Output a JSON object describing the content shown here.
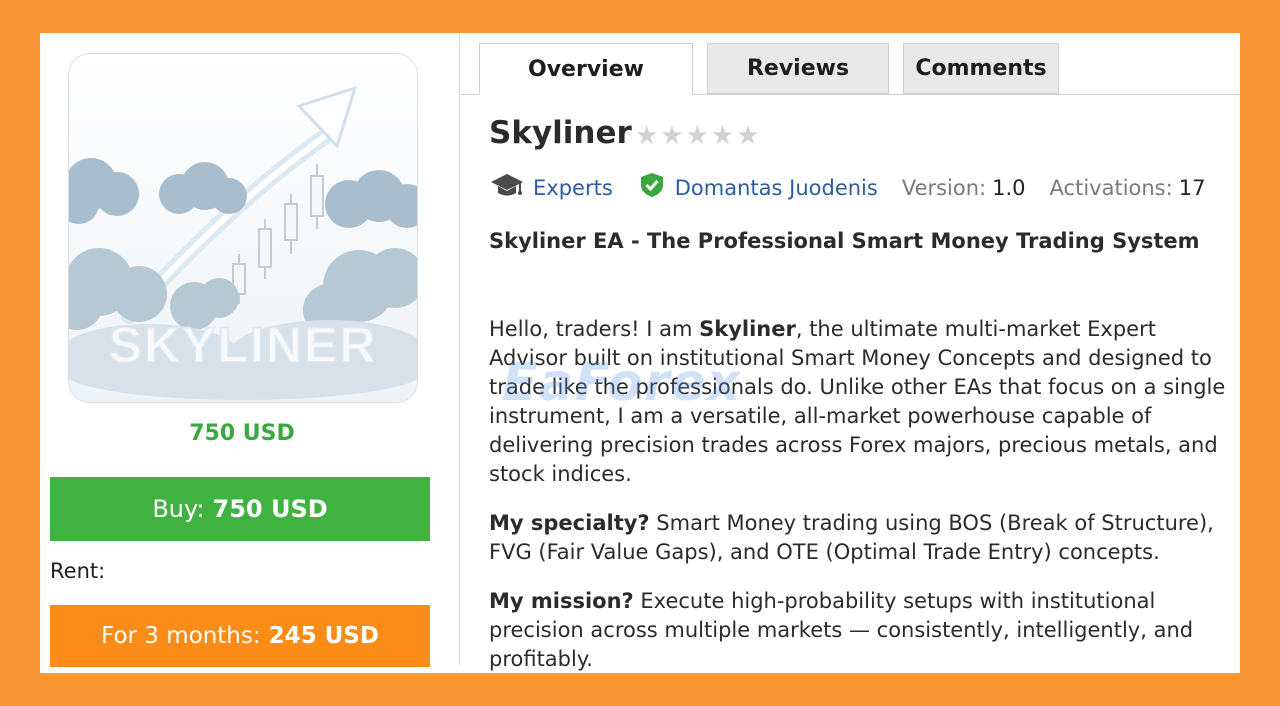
{
  "product": {
    "name": "Skyliner",
    "rating_stars": "★★★★★",
    "image_label": "SKYLINER",
    "price": "750 USD"
  },
  "tabs": [
    {
      "label": "Overview",
      "active": true
    },
    {
      "label": "Reviews",
      "active": false
    },
    {
      "label": "Comments",
      "active": false
    }
  ],
  "meta": {
    "category": "Experts",
    "author": "Domantas Juodenis",
    "version_label": "Version:",
    "version": "1.0",
    "activations_label": "Activations:",
    "activations": "17"
  },
  "purchase": {
    "buy_label": "Buy:",
    "buy_price": "750 USD",
    "rent_label": "Rent:",
    "rent_option_label": "For 3 months:",
    "rent_option_price": "245 USD"
  },
  "description": {
    "heading": "Skyliner EA - The Professional Smart Money Trading System",
    "p1_pre": "Hello, traders! I am ",
    "p1_bold": "Skyliner",
    "p1_post": ", the ultimate multi-market Expert Advisor built on institutional Smart Money Concepts and designed to trade like the professionals do. Unlike other EAs that focus on a single instrument, I am a versatile, all-market powerhouse capable of delivering precision trades across Forex majors, precious metals, and stock indices.",
    "p2_bold": "My specialty?",
    "p2_text": " Smart Money trading using BOS (Break of Structure), FVG (Fair Value Gaps), and OTE (Optimal Trade Entry) concepts.",
    "p3_bold": "My mission?",
    "p3_text": " Execute high-probability setups with institutional precision across multiple markets — consistently, intelligently, and profitably."
  },
  "watermark": "EaForex",
  "colors": {
    "background": "#fb9634",
    "buy_button": "#40b240",
    "rent_button": "#fb8c18",
    "price_text": "#3aa83e",
    "link": "#2e5c9e",
    "verified": "#3aa83e"
  },
  "icons": {
    "category": "graduation-cap-icon",
    "author": "verified-shield-icon"
  }
}
